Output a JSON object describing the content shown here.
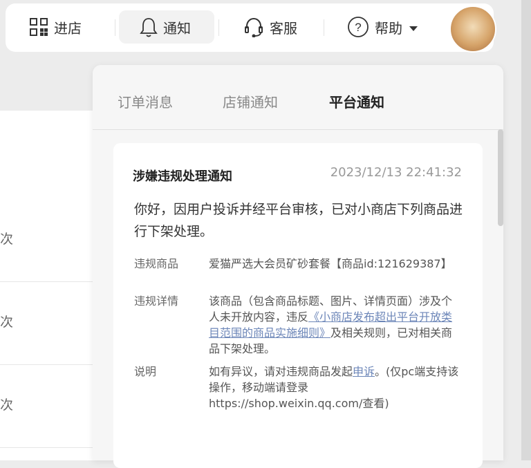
{
  "nav": {
    "enter_store": "进店",
    "notification": "通知",
    "customer_service": "客服",
    "help": "帮助"
  },
  "background_rows": [
    "次",
    "次",
    "次"
  ],
  "panel": {
    "tabs": [
      "订单消息",
      "店铺通知",
      "平台通知"
    ],
    "active_tab": "平台通知"
  },
  "card": {
    "title": "涉嫌违规处理通知",
    "time": "2023/12/13 22:41:32",
    "body": "你好，因用户投诉并经平台审核，已对小商店下列商品进行下架处理。",
    "fields": {
      "product_label": "违规商品",
      "product_value": "爱猫严选大会员矿砂套餐【商品id:121629387】",
      "details_label": "违规详情",
      "details_prefix": "该商品（包含商品标题、图片、详情页面）涉及个人未开放内容，违反",
      "details_link": "《小商店发布超出平台开放类目范围的商品实施细则》",
      "details_suffix": "及相关规则，已对相关商品下架处理。",
      "note_label": "说明",
      "note_prefix": "如有异议，请对违规商品发起",
      "note_link": "申诉",
      "note_suffix": "。(仅pc端支持该操作，移动端请登录https://shop.weixin.qq.com/查看)"
    }
  }
}
